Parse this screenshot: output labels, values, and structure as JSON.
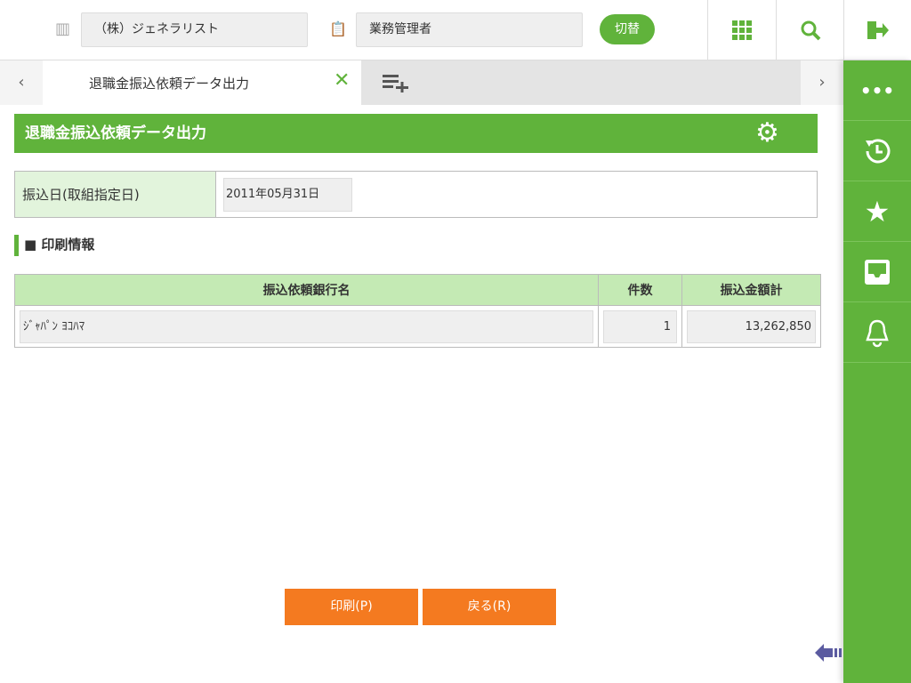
{
  "header": {
    "company": "（株）ジェネラリスト",
    "role": "業務管理者",
    "switch_label": "切替"
  },
  "tabs": {
    "active_label": "退職金振込依頼データ出力"
  },
  "page": {
    "title": "退職金振込依頼データ出力"
  },
  "form": {
    "date_label": "振込日(取組指定日)",
    "date_value": "2011年05月31日"
  },
  "section": {
    "title": "■ 印刷情報"
  },
  "table": {
    "headers": [
      "振込依頼銀行名",
      "件数",
      "振込金額計"
    ],
    "rows": [
      {
        "bank": "ｼﾞｬﾊﾟﾝ ﾖｺﾊﾏ",
        "count": "1",
        "amount": "13,262,850"
      }
    ]
  },
  "buttons": {
    "print": "印刷(P)",
    "back": "戻る(R)"
  }
}
